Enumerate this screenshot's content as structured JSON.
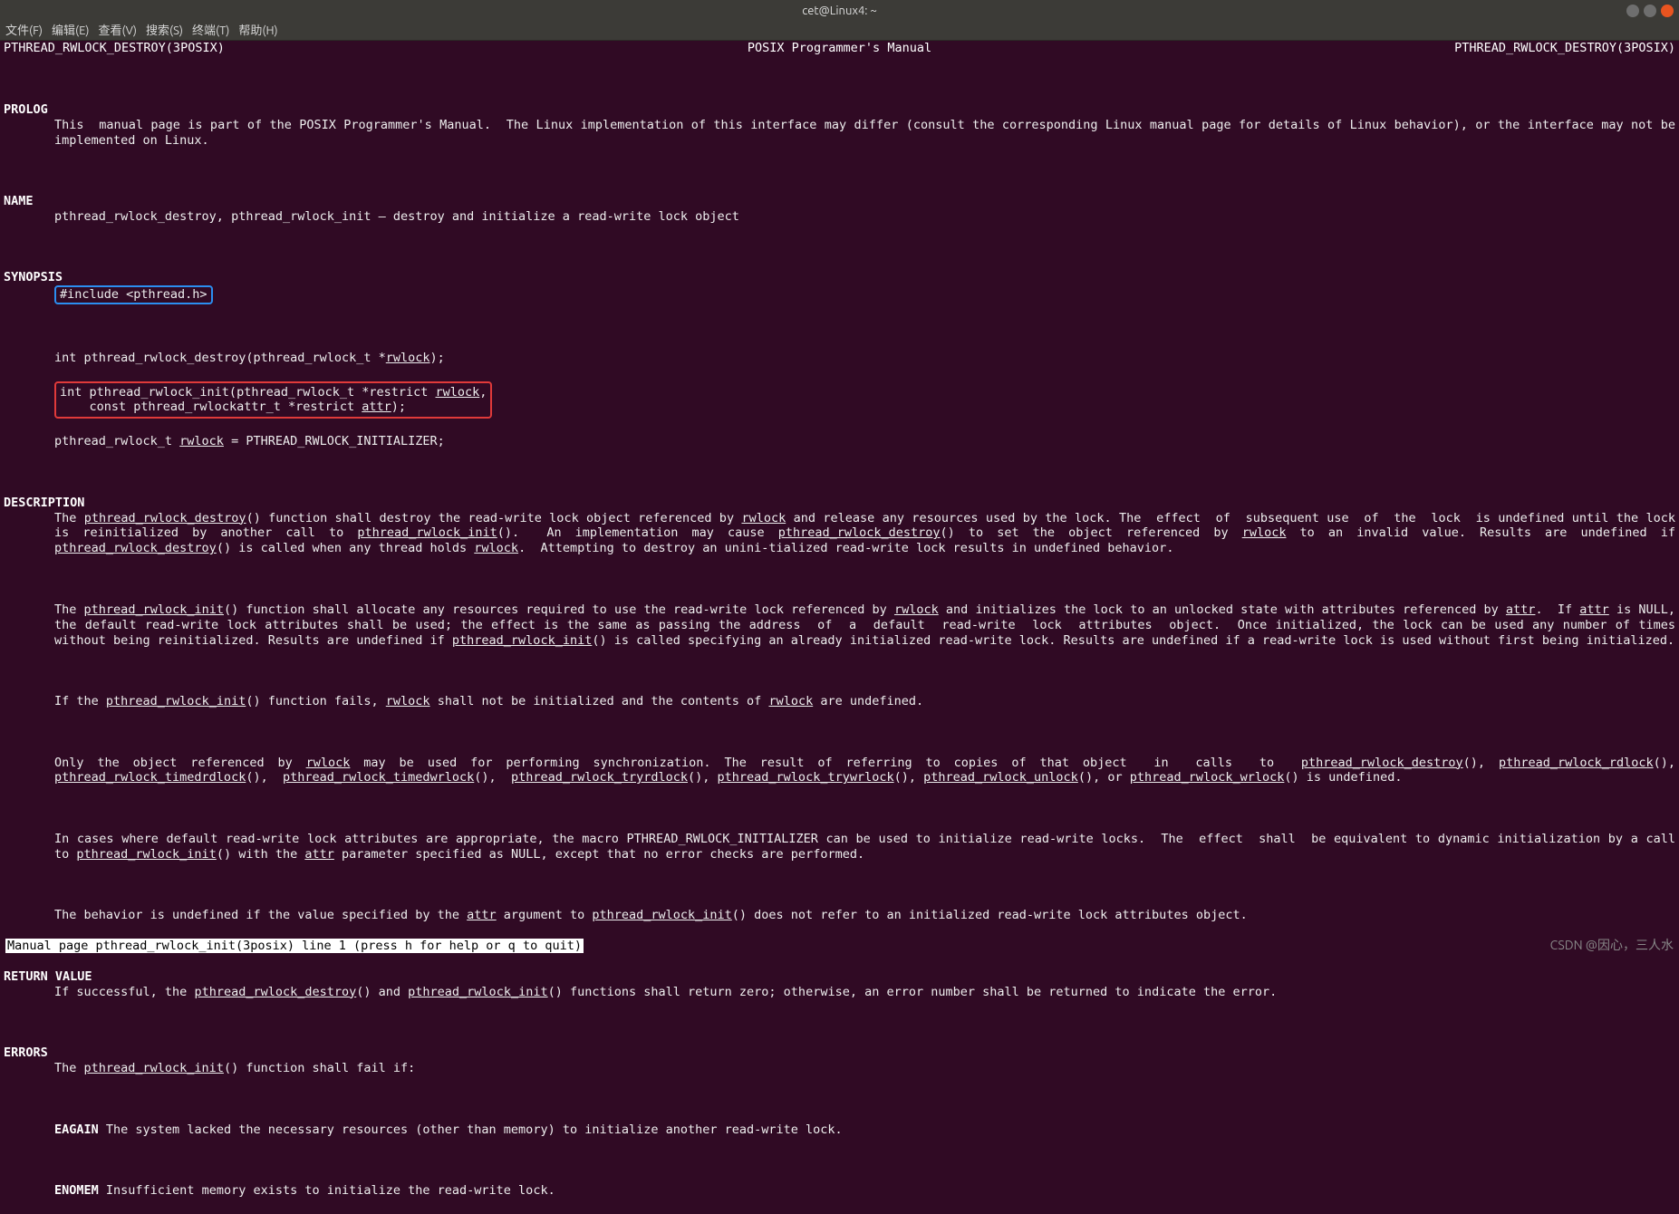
{
  "window": {
    "title": "cet@Linux4: ~"
  },
  "menubar": [
    "文件(F)",
    "编辑(E)",
    "查看(V)",
    "搜索(S)",
    "终端(T)",
    "帮助(H)"
  ],
  "header": {
    "left": "PTHREAD_RWLOCK_DESTROY(3POSIX)",
    "center": "POSIX Programmer's Manual",
    "right": "PTHREAD_RWLOCK_DESTROY(3POSIX)"
  },
  "sections": {
    "prolog_h": "PROLOG",
    "prolog_t": "This  manual page is part of the POSIX Programmer's Manual.  The Linux implementation of this interface may differ (consult the corresponding Linux manual page for details of Linux behavior), or the interface may not be implemented on Linux.",
    "name_h": "NAME",
    "name_t": "pthread_rwlock_destroy, pthread_rwlock_init — destroy and initialize a read-write lock object",
    "synopsis_h": "SYNOPSIS",
    "syn_include": "#include <pthread.h>",
    "syn_l1a": "int pthread_rwlock_destroy(pthread_rwlock_t *",
    "syn_l1b": "rwlock",
    "syn_l1c": ");",
    "syn_l2a": "int pthread_rwlock_init(pthread_rwlock_t *restrict ",
    "syn_l2b": "rwlock",
    "syn_l2c": ",",
    "syn_l3a": "    const pthread_rwlockattr_t *restrict ",
    "syn_l3b": "attr",
    "syn_l3c": ");",
    "syn_l4a": "pthread_rwlock_t ",
    "syn_l4b": "rwlock",
    "syn_l4c": " = PTHREAD_RWLOCK_INITIALIZER;",
    "desc_h": "DESCRIPTION",
    "desc_p1_a": "The ",
    "desc_p1_b": "pthread_rwlock_destroy",
    "desc_p1_c": "() function shall destroy the read-write lock object referenced by ",
    "desc_p1_d": "rwlock",
    "desc_p1_e": " and release any resources used by the lock. The  effect  of  subsequent use  of  the  lock  is undefined until the lock is reinitialized by another call to ",
    "desc_p1_f": "pthread_rwlock_init",
    "desc_p1_g": "().  An implementation may cause ",
    "desc_p1_h": "pthread_rwlock_destroy",
    "desc_p1_i": "() to set the object referenced by ",
    "desc_p1_j": "rwlock",
    "desc_p1_k": " to an invalid value. Results are undefined if ",
    "desc_p1_l": "pthread_rwlock_destroy",
    "desc_p1_m": "() is called when any thread holds ",
    "desc_p1_n": "rwlock",
    "desc_p1_o": ".  Attempting to destroy an unini‐tialized read-write lock results in undefined behavior.",
    "desc_p2_a": "The ",
    "desc_p2_b": "pthread_rwlock_init",
    "desc_p2_c": "() function shall allocate any resources required to use the read-write lock referenced by ",
    "desc_p2_d": "rwlock",
    "desc_p2_e": " and initializes the lock to an unlocked state with attributes referenced by ",
    "desc_p2_f": "attr",
    "desc_p2_g": ".  If ",
    "desc_p2_h": "attr",
    "desc_p2_i": " is NULL, the default read-write lock attributes shall be used; the effect is the same as passing the address  of  a  default  read-write  lock  attributes  object.  Once initialized, the lock can be used any number of times without being reinitialized. Results are undefined if ",
    "desc_p2_j": "pthread_rwlock_init",
    "desc_p2_k": "() is called specifying an already initialized read-write lock. Results are undefined if a read-write lock is used without first being initialized.",
    "desc_p3_a": "If the ",
    "desc_p3_b": "pthread_rwlock_init",
    "desc_p3_c": "() function fails, ",
    "desc_p3_d": "rwlock",
    "desc_p3_e": " shall not be initialized and the contents of ",
    "desc_p3_f": "rwlock",
    "desc_p3_g": " are undefined.",
    "desc_p4_a": "Only the object referenced by ",
    "desc_p4_b": "rwlock",
    "desc_p4_c": " may be used for performing synchronization. The result of referring to copies of that object  in  calls  to  ",
    "desc_p4_d": "pthread_rwlock_destroy",
    "desc_p4_e": "(), ",
    "desc_p4_f": "pthread_rwlock_rdlock",
    "desc_p4_g": "(),  ",
    "desc_p4_h": "pthread_rwlock_timedrdlock",
    "desc_p4_i": "(),  ",
    "desc_p4_j": "pthread_rwlock_timedwrlock",
    "desc_p4_k": "(),  ",
    "desc_p4_l": "pthread_rwlock_tryrdlock",
    "desc_p4_m": "(), ",
    "desc_p4_n": "pthread_rwlock_trywrlock",
    "desc_p4_o": "(), ",
    "desc_p4_p": "pthread_rwlock_unlock",
    "desc_p4_q": "(), or ",
    "desc_p4_r": "pthread_rwlock_wrlock",
    "desc_p4_s": "() is undefined.",
    "desc_p5_a": "In cases where default read-write lock attributes are appropriate, the macro PTHREAD_RWLOCK_INITIALIZER can be used to initialize read-write locks.  The  effect  shall  be equivalent to dynamic initialization by a call to ",
    "desc_p5_b": "pthread_rwlock_init",
    "desc_p5_c": "() with the ",
    "desc_p5_d": "attr",
    "desc_p5_e": " parameter specified as NULL, except that no error checks are performed.",
    "desc_p6_a": "The behavior is undefined if the value specified by the ",
    "desc_p6_b": "attr",
    "desc_p6_c": " argument to ",
    "desc_p6_d": "pthread_rwlock_init",
    "desc_p6_e": "() does not refer to an initialized read-write lock attributes object.",
    "retval_h": "RETURN VALUE",
    "retval_a": "If successful, the ",
    "retval_b": "pthread_rwlock_destroy",
    "retval_c": "() and ",
    "retval_d": "pthread_rwlock_init",
    "retval_e": "() functions shall return zero; otherwise, an error number shall be returned to indicate the error.",
    "errors_h": "ERRORS",
    "errors_a": "The ",
    "errors_b": "pthread_rwlock_init",
    "errors_c": "() function shall fail if:",
    "err1_code": "EAGAIN",
    "err1_text": " The system lacked the necessary resources (other than memory) to initialize another read-write lock.",
    "err2_code": "ENOMEM",
    "err2_text": " Insufficient memory exists to initialize the read-write lock."
  },
  "statusbar": " Manual page pthread_rwlock_init(3posix) line 1 (press h for help or q to quit)",
  "watermark": "CSDN @因心，三人水"
}
